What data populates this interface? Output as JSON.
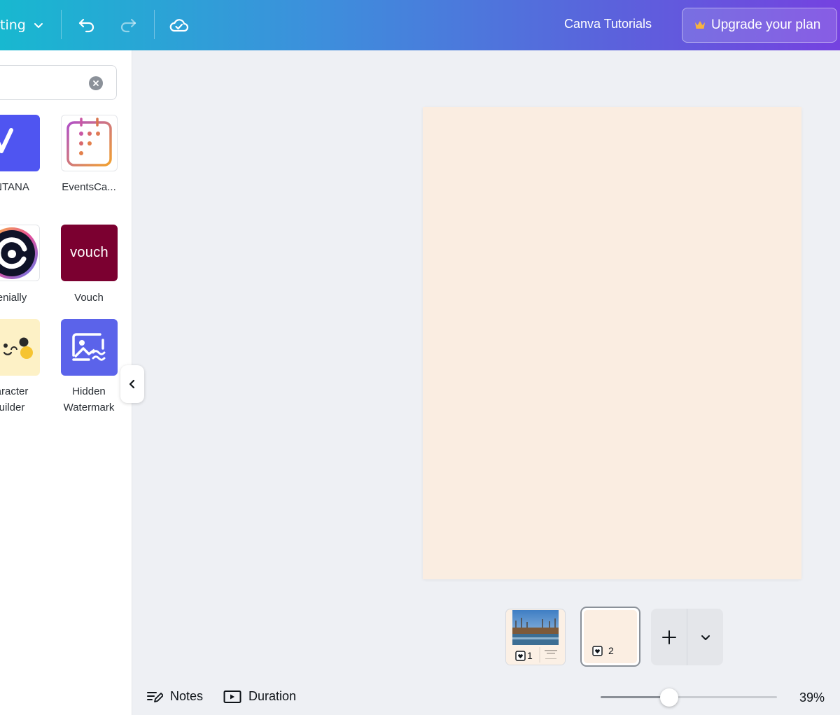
{
  "topbar": {
    "resize_label": "ting",
    "tutorials_label": "Canva Tutorials",
    "upgrade_label": "Upgrade your plan",
    "icons": [
      "chevron-down-icon",
      "undo-icon",
      "redo-icon",
      "cloud-check-icon",
      "crown-icon"
    ]
  },
  "panel": {
    "search_value": "",
    "apps": [
      {
        "label": "NTANA",
        "icon": "ntana-logo"
      },
      {
        "label": "EventsCa...",
        "icon": "calendar-logo"
      },
      {
        "label": "enially",
        "icon": "genially-logo"
      },
      {
        "label": "Vouch",
        "icon": "vouch-logo",
        "logo_text": "vouch"
      },
      {
        "label_line1": "aracter",
        "label_line2": "uilder",
        "icon": "character-builder-logo"
      },
      {
        "label_line1": "Hidden",
        "label_line2": "Watermark",
        "icon": "hidden-watermark-logo"
      }
    ]
  },
  "pages": {
    "thumb1_number": "1",
    "thumb2_number": "2"
  },
  "footer": {
    "notes_label": "Notes",
    "duration_label": "Duration",
    "zoom_value": "39%",
    "zoom_level": 0.39
  },
  "colors": {
    "gradient_start": "#18b8d0",
    "gradient_end": "#7542e0",
    "canvas_bg": "#faede1",
    "vouch_bg": "#7b0030",
    "ntana_bg": "#4f55f1",
    "watermark_bg": "#5b63ea"
  }
}
